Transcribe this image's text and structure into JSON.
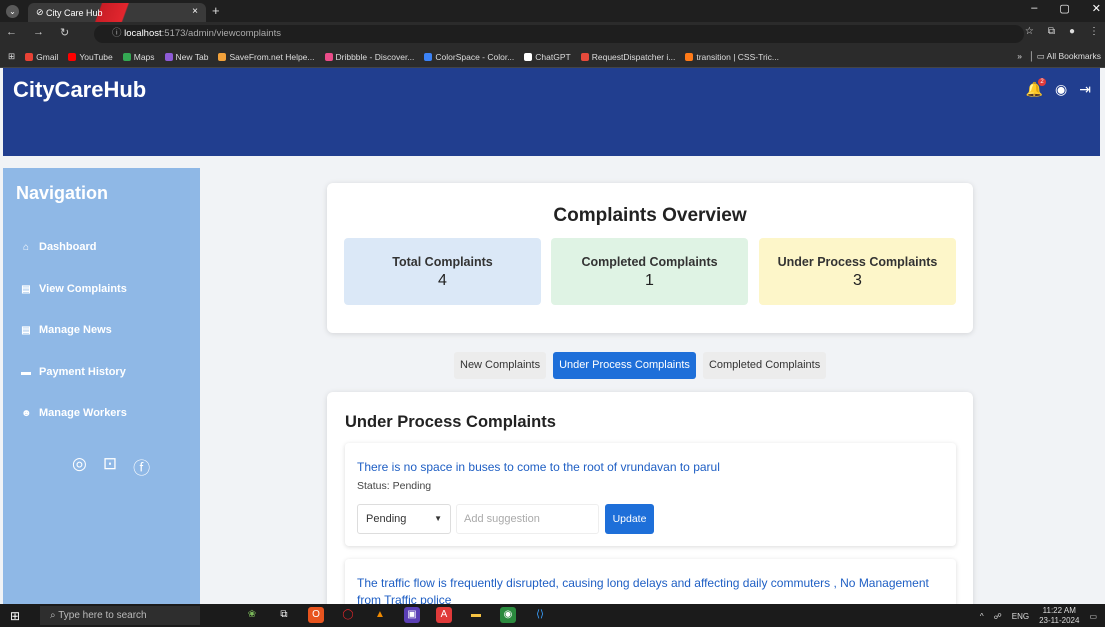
{
  "browser": {
    "tab_title": "City Care Hub",
    "tab_close": "×",
    "new_tab": "+",
    "url_host": "localhost",
    "url_path": ":5173/admin/viewcomplaints",
    "bookmarks": [
      {
        "label": "Gmail",
        "color": "#e84235"
      },
      {
        "label": "YouTube",
        "color": "#ff0000"
      },
      {
        "label": "Maps",
        "color": "#34a853"
      },
      {
        "label": "New Tab",
        "color": "#8e5bd6"
      },
      {
        "label": "SaveFrom.net Helpe...",
        "color": "#f2a23b"
      },
      {
        "label": "Dribbble - Discover...",
        "color": "#ea4c89"
      },
      {
        "label": "ColorSpace - Color...",
        "color": "#3b82f6"
      },
      {
        "label": "ChatGPT",
        "color": "#ffffff"
      },
      {
        "label": "RequestDispatcher i...",
        "color": "#e64a3b"
      },
      {
        "label": "transition | CSS-Tric...",
        "color": "#ff7a18"
      }
    ],
    "bookmarks_more": "»",
    "all_bookmarks": "All Bookmarks"
  },
  "header": {
    "brand": "CityCareHub",
    "notification_count": "2"
  },
  "sidebar": {
    "title": "Navigation",
    "items": [
      {
        "label": "Dashboard",
        "icon": "home-icon"
      },
      {
        "label": "View Complaints",
        "icon": "list-icon"
      },
      {
        "label": "Manage News",
        "icon": "news-icon"
      },
      {
        "label": "Payment History",
        "icon": "payment-icon"
      },
      {
        "label": "Manage Workers",
        "icon": "workers-icon"
      }
    ]
  },
  "overview": {
    "title": "Complaints Overview",
    "stats": [
      {
        "label": "Total Complaints",
        "value": "4",
        "color": "#dbe8f7"
      },
      {
        "label": "Completed Complaints",
        "value": "1",
        "color": "#dff3e4"
      },
      {
        "label": "Under Process Complaints",
        "value": "3",
        "color": "#fdf6c9"
      }
    ]
  },
  "tabs": [
    {
      "label": "New Complaints",
      "active": false
    },
    {
      "label": "Under Process Complaints",
      "active": true
    },
    {
      "label": "Completed Complaints",
      "active": false
    }
  ],
  "list": {
    "title": "Under Process Complaints",
    "items": [
      {
        "title": "There is no space in buses to come to the root of vrundavan to parul",
        "status": "Status: Pending",
        "select_value": "Pending",
        "suggestion_placeholder": "Add suggestion",
        "update_label": "Update"
      },
      {
        "title": "The traffic flow is frequently disrupted, causing long delays and affecting daily commuters , No Management from Traffic police"
      }
    ]
  },
  "taskbar": {
    "search_placeholder": "Type here to search",
    "tray_lang": "ENG",
    "time": "11:22 AM",
    "date": "23-11-2024"
  }
}
